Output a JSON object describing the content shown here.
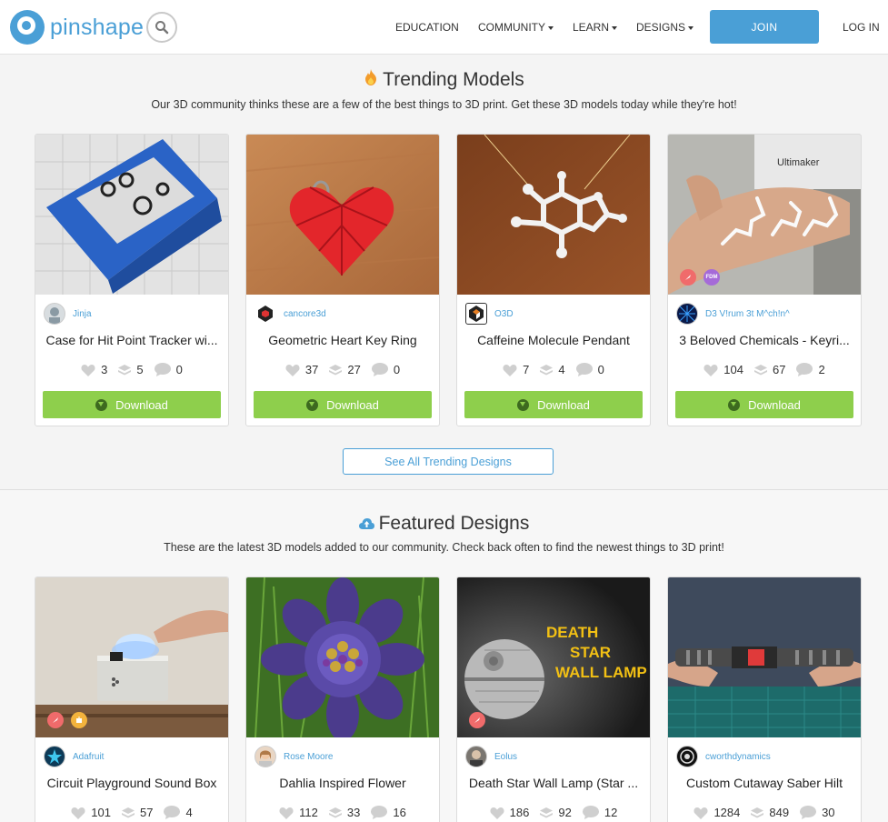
{
  "header": {
    "logo_text": "pinshape",
    "nav": [
      {
        "label": "EDUCATION",
        "dropdown": false
      },
      {
        "label": "COMMUNITY",
        "dropdown": true
      },
      {
        "label": "LEARN",
        "dropdown": true
      },
      {
        "label": "DESIGNS",
        "dropdown": true
      }
    ],
    "join_label": "JOIN",
    "login_label": "LOG IN"
  },
  "trending": {
    "title": "Trending Models",
    "subtitle": "Our 3D community thinks these are a few of the best things to 3D print. Get these 3D models today while they're hot!",
    "see_all_label": "See All Trending Designs",
    "cards": [
      {
        "author": "Jinja",
        "title": "Case for Hit Point Tracker wi...",
        "likes": "3",
        "prints": "5",
        "comments": "0",
        "download_label": "Download"
      },
      {
        "author": "cancore3d",
        "title": "Geometric Heart Key Ring",
        "likes": "37",
        "prints": "27",
        "comments": "0",
        "download_label": "Download"
      },
      {
        "author": "O3D",
        "title": "Caffeine Molecule Pendant",
        "likes": "7",
        "prints": "4",
        "comments": "0",
        "download_label": "Download"
      },
      {
        "author": "D3 V!rum 3t M^ch!n^",
        "title": "3 Beloved Chemicals - Keyri...",
        "likes": "104",
        "prints": "67",
        "comments": "2",
        "download_label": "Download",
        "badge_text": "FDM"
      }
    ]
  },
  "featured": {
    "title": "Featured Designs",
    "subtitle": "These are the latest 3D models added to our community. Check back often to find the newest things to 3D print!",
    "cards": [
      {
        "author": "Adafruit",
        "title": "Circuit Playground Sound Box",
        "likes": "101",
        "prints": "57",
        "comments": "4"
      },
      {
        "author": "Rose Moore",
        "title": "Dahlia Inspired Flower",
        "likes": "112",
        "prints": "33",
        "comments": "16"
      },
      {
        "author": "Eolus",
        "title": "Death Star Wall Lamp (Star ...",
        "likes": "186",
        "prints": "92",
        "comments": "12",
        "image_text": [
          "DEATH",
          "STAR",
          "WALL LAMP"
        ]
      },
      {
        "author": "cworthdynamics",
        "title": "Custom Cutaway Saber Hilt",
        "likes": "1284",
        "prints": "849",
        "comments": "30"
      }
    ]
  },
  "colors": {
    "brand_blue": "#4a9fd6",
    "download_green": "#8ecf4c"
  }
}
